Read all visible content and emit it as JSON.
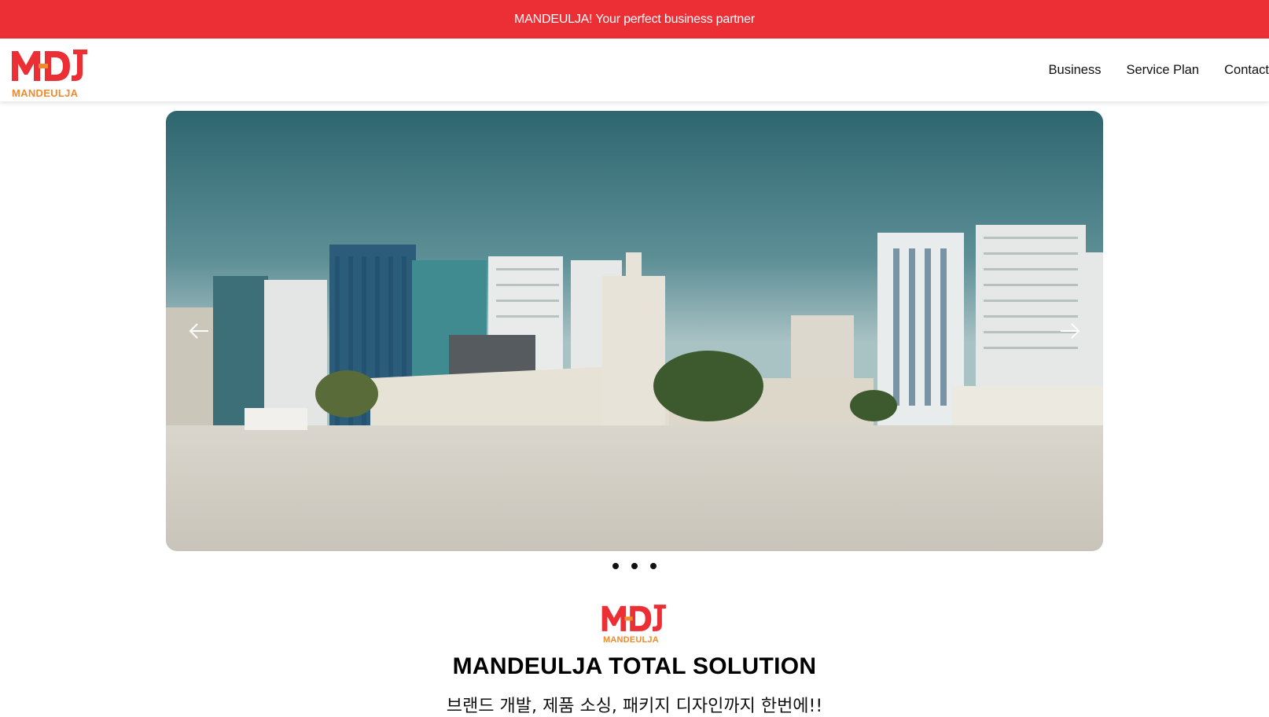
{
  "announcement": {
    "text": "MANDEULJA! Your perfect business partner"
  },
  "header": {
    "logo_text": "MANDEULJA",
    "nav": [
      {
        "label": "Business"
      },
      {
        "label": "Service Plan"
      },
      {
        "label": "Contact"
      }
    ]
  },
  "hero": {
    "slide_count": 3,
    "prev_icon": "arrow-left-icon",
    "next_icon": "arrow-right-icon"
  },
  "intro": {
    "logo_text": "MANDEULJA",
    "title": "MANDEULJA TOTAL SOLUTION",
    "subtitle": "브랜드 개발, 제품 소싱, 패키지 디자인까지 한번에!!"
  },
  "colors": {
    "brand_red": "#ec2e35",
    "brand_orange": "#f08a2c"
  }
}
